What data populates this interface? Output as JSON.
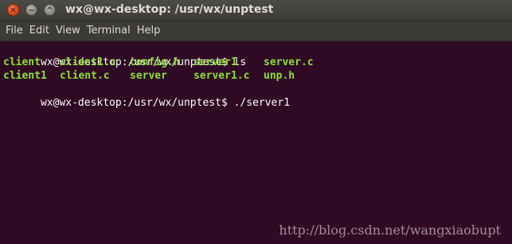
{
  "window": {
    "title": "wx@wx-desktop: /usr/wx/unptest",
    "buttons": {
      "close": "✕",
      "minimize": "−",
      "maximize": "^"
    }
  },
  "menubar": {
    "items": [
      "File",
      "Edit",
      "View",
      "Terminal",
      "Help"
    ]
  },
  "terminal": {
    "prompt1": "wx@wx-desktop:/usr/wx/unptest$ ls",
    "ls_row1": [
      "client",
      "client1.c",
      "config.h",
      "server1",
      "server.c"
    ],
    "ls_row2": [
      "client1",
      "client.c",
      "server",
      "server1.c",
      "unp.h"
    ],
    "prompt2": "wx@wx-desktop:/usr/wx/unptest$ ./server1",
    "colors": {
      "background": "#300a24",
      "text": "#ffffff",
      "file_listing": "#8ae234"
    }
  },
  "watermark": "http://blog.csdn.net/wangxiaobupt"
}
